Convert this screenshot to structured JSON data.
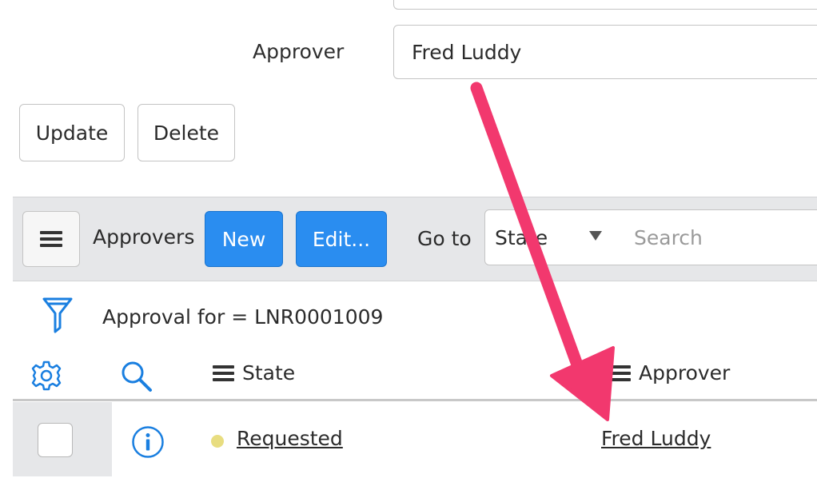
{
  "form": {
    "approver_label": "Approver",
    "approver_value": "Fred Luddy",
    "update_label": "Update",
    "delete_label": "Delete"
  },
  "list": {
    "title": "Approvers",
    "new_label": "New",
    "edit_label": "Edit...",
    "goto_label": "Go to",
    "goto_field": "State",
    "search_placeholder": "Search",
    "filter_text": "Approval for = LNR0001009",
    "columns": [
      {
        "label": "State"
      },
      {
        "label": "Approver"
      }
    ],
    "rows": [
      {
        "state": "Requested",
        "approver": "Fred Luddy",
        "state_color": "#e8dd80"
      }
    ]
  },
  "colors": {
    "primary_button": "#2a8df0",
    "icon_blue": "#1a7fe0",
    "annotation_arrow": "#f2386e"
  },
  "icons": [
    "menu-icon",
    "caret-down-icon",
    "filter-icon",
    "gear-icon",
    "search-icon",
    "info-icon",
    "annotation-arrow"
  ]
}
